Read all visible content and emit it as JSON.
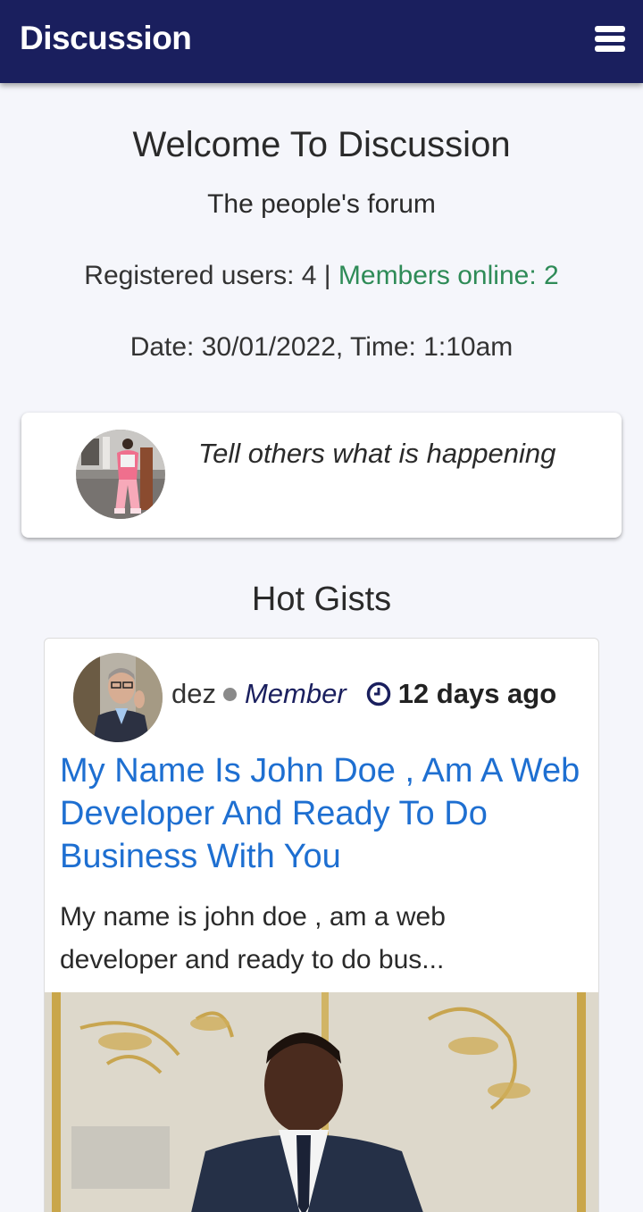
{
  "header": {
    "title": "Discussion",
    "menu_icon": "hamburger-menu-icon"
  },
  "hero": {
    "welcome": "Welcome To Discussion",
    "tagline": "The people's forum",
    "registered_label": "Registered users: 4 | ",
    "online_label": "Members online: 2",
    "datetime": "Date: 30/01/2022, Time: 1:10am"
  },
  "composer": {
    "prompt": "Tell others what is happening"
  },
  "section": {
    "title": "Hot Gists"
  },
  "post": {
    "author": "dez",
    "role": "Member",
    "time_ago": "12 days ago",
    "title": "My Name Is John Doe , Am A Web Developer And Ready To Do Business With You",
    "excerpt": "My name is john doe , am a web developer and ready to do bus..."
  },
  "colors": {
    "header_bg": "#1a1f5e",
    "online_green": "#2e8b57",
    "link_blue": "#1e6fd1",
    "page_bg": "#f5f6fb"
  }
}
